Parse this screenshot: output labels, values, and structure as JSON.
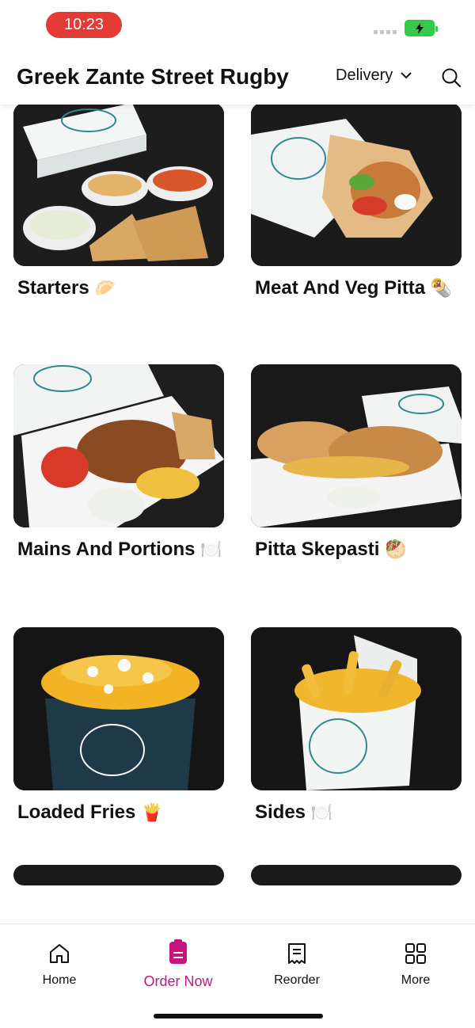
{
  "status": {
    "time": "10:23"
  },
  "header": {
    "title": "Greek Zante Street Rugby",
    "mode": "Delivery"
  },
  "categories": [
    {
      "name": "Starters",
      "emoji": "🥟",
      "image": "hummus, dips and pitta bread with Greek box"
    },
    {
      "name": "Meat And Veg Pitta",
      "emoji": "🌯",
      "image": "wrapped chicken pitta"
    },
    {
      "name": "Mains And Portions",
      "emoji": "🍽️",
      "image": "meat, chips, tomato and pitta in box"
    },
    {
      "name": "Pitta Skepasti",
      "emoji": "🥙",
      "image": "grilled covered pitta in tray"
    },
    {
      "name": "Loaded Fries",
      "emoji": "🍟",
      "image": "loaded fries with cheese in dark Greek box"
    },
    {
      "name": "Sides",
      "emoji": "🍽️",
      "image": "fries in white Greek box"
    }
  ],
  "nav": [
    {
      "label": "Home",
      "icon": "home-icon"
    },
    {
      "label": "Order Now",
      "icon": "order-icon"
    },
    {
      "label": "Reorder",
      "icon": "receipt-icon"
    },
    {
      "label": "More",
      "icon": "grid-icon"
    }
  ],
  "colors": {
    "accent": "#c7157f",
    "time_pill": "#e33b35",
    "battery": "#38c94a"
  }
}
